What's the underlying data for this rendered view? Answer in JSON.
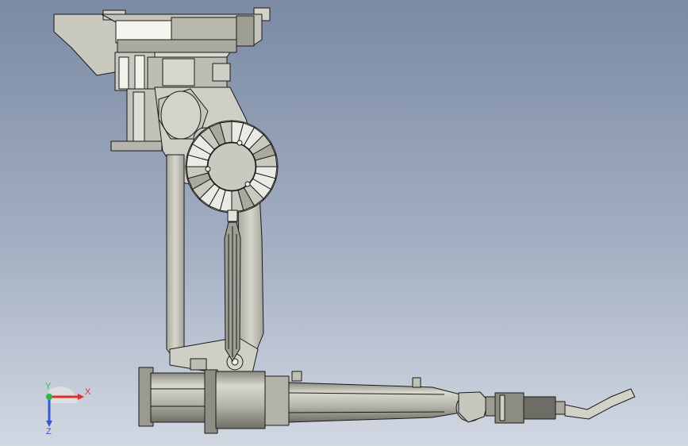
{
  "triad": {
    "x_label": "X",
    "y_label": "Y",
    "z_label": "Z",
    "x_color": "#e0302a",
    "y_color": "#2fb84a",
    "z_color": "#3a56c8"
  },
  "colors": {
    "background_top": "#7b8aa4",
    "background_bottom": "#d2d8e2",
    "part_fill": "#c9c9c0",
    "part_shade": "#a9a99f",
    "part_light": "#ebebe6",
    "edge": "#1a1a1a"
  }
}
